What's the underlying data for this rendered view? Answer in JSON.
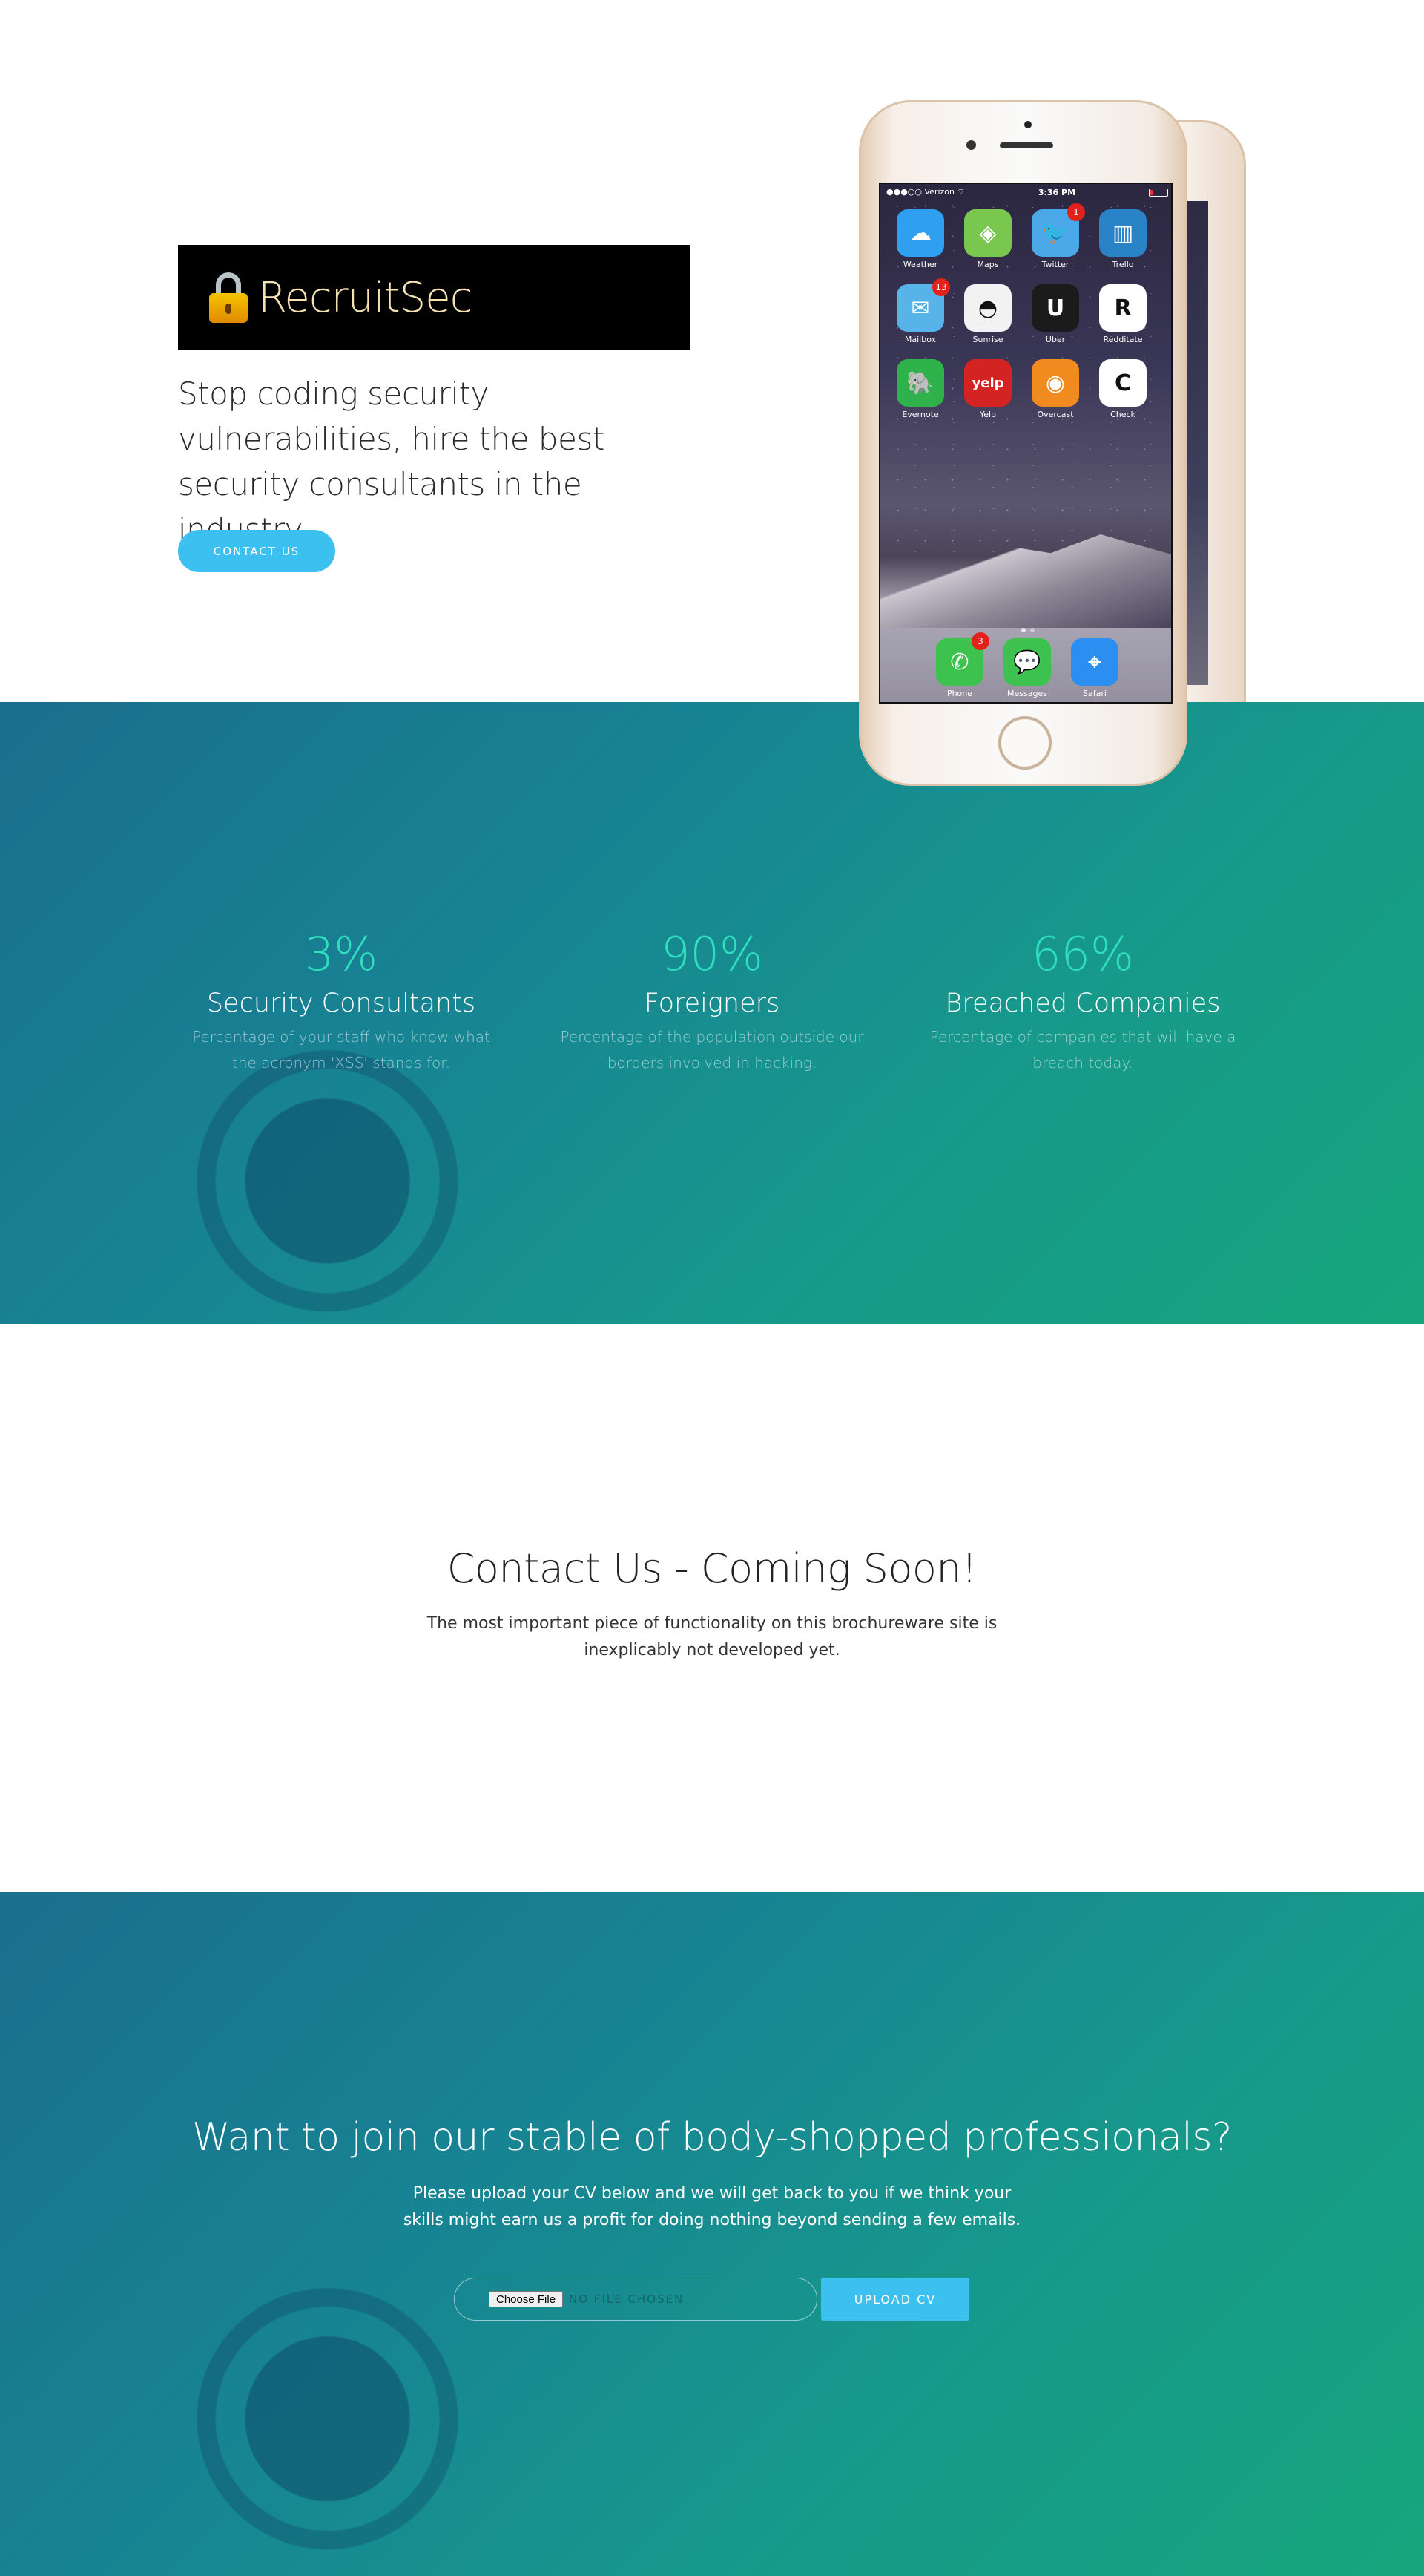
{
  "hero": {
    "brand": "RecruitSec",
    "tagline": "Stop coding security vulnerabilities, hire the best security consultants in the industry.",
    "contact_button": "CONTACT US"
  },
  "phone": {
    "carrier": "Verizon",
    "time": "3:36 PM",
    "apps": [
      {
        "label": "Weather",
        "glyph": "☁",
        "color": "#2f9ff0",
        "badge": ""
      },
      {
        "label": "Maps",
        "glyph": "◈",
        "color": "#7ac74f",
        "badge": ""
      },
      {
        "label": "Twitter",
        "glyph": "🐦",
        "color": "#4aa8e8",
        "badge": "1"
      },
      {
        "label": "Trello",
        "glyph": "▥",
        "color": "#2a83c6",
        "badge": ""
      },
      {
        "label": "Mailbox",
        "glyph": "✉",
        "color": "#58b4e8",
        "badge": "13"
      },
      {
        "label": "Sunrise",
        "glyph": "◓",
        "color": "#f2f2f2",
        "badge": ""
      },
      {
        "label": "Uber",
        "glyph": "U",
        "color": "#1b1b1b",
        "badge": ""
      },
      {
        "label": "Redditate",
        "glyph": "R",
        "color": "#ffffff",
        "badge": ""
      },
      {
        "label": "Evernote",
        "glyph": "🐘",
        "color": "#2fb24c",
        "badge": ""
      },
      {
        "label": "Yelp",
        "glyph": "yelp",
        "color": "#d32323",
        "badge": ""
      },
      {
        "label": "Overcast",
        "glyph": "◉",
        "color": "#f18b1f",
        "badge": ""
      },
      {
        "label": "Check",
        "glyph": "C",
        "color": "#ffffff",
        "badge": ""
      }
    ],
    "dock": [
      {
        "label": "Phone",
        "glyph": "✆",
        "color": "#3ec24f",
        "badge": "3"
      },
      {
        "label": "Messages",
        "glyph": "💬",
        "color": "#3ec24f",
        "badge": ""
      },
      {
        "label": "Safari",
        "glyph": "⌖",
        "color": "#2a8ff0",
        "badge": ""
      }
    ]
  },
  "stats": [
    {
      "number": "3%",
      "title": "Security Consultants",
      "desc": "Percentage of your staff who know what the acronym 'XSS' stands for."
    },
    {
      "number": "90%",
      "title": "Foreigners",
      "desc": "Percentage of the population outside our borders involved in hacking."
    },
    {
      "number": "66%",
      "title": "Breached Companies",
      "desc": "Percentage of companies that will have a breach today."
    }
  ],
  "contact": {
    "title": "Contact Us - Coming Soon!",
    "text": "The most important piece of functionality on this brochureware site is inexplicably not developed yet."
  },
  "join": {
    "title": "Want to join our stable of body-shopped professionals?",
    "text": "Please upload your CV below and we will get back to you if we think your skills might earn us a profit for doing nothing beyond sending a few emails.",
    "choose_file": "Choose File",
    "no_file": "NO FILE CHOSEN",
    "upload_button": "UPLOAD CV"
  },
  "colors": {
    "accent": "#3cc0ef",
    "stat_number": "#2fe0c0",
    "band_start": "#1a6f8c",
    "band_end": "#16a67c"
  }
}
